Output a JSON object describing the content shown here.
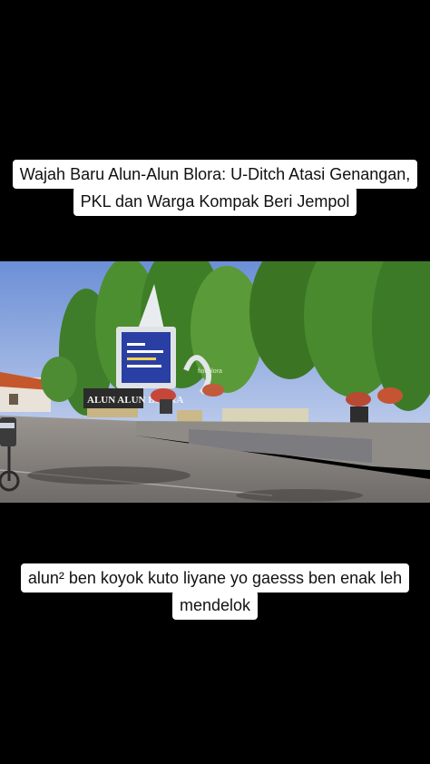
{
  "top_caption": {
    "line1": "Wajah Baru Alun-Alun Blora: U-Ditch Atasi Genangan,",
    "line2": "PKL dan Warga Kompak Beri Jempol"
  },
  "photo": {
    "sign_text": "ALUN ALUN BLORA",
    "watermark": "fiot blora"
  },
  "bottom_caption": {
    "line1": "alun² ben koyok kuto liyane yo gaesss ben enak leh",
    "line2": "mendelok"
  }
}
